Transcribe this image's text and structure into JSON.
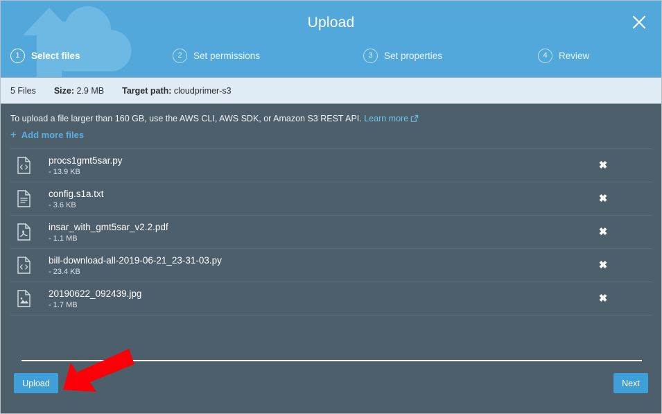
{
  "header": {
    "title": "Upload",
    "close_label": "✕",
    "watermark_icon": "cloud-upload-icon",
    "steps": [
      {
        "num": "1",
        "label": "Select files",
        "active": true
      },
      {
        "num": "2",
        "label": "Set permissions",
        "active": false
      },
      {
        "num": "3",
        "label": "Set properties",
        "active": false
      },
      {
        "num": "4",
        "label": "Review",
        "active": false
      }
    ]
  },
  "infobar": {
    "file_count": "5 Files",
    "size_key": "Size:",
    "size_value": "2.9 MB",
    "target_key": "Target path:",
    "target_value": "cloudprimer-s3"
  },
  "notice": {
    "text": "To upload a file larger than 160 GB, use the AWS CLI, AWS SDK, or Amazon S3 REST API.",
    "link_label": "Learn more",
    "link_icon": "external-link-icon"
  },
  "add_more": {
    "plus": "+",
    "label": "Add more files"
  },
  "files": [
    {
      "name": "procs1gmt5sar.py",
      "size": "- 13.9 KB",
      "icon": "code-file-icon",
      "remove": "✖"
    },
    {
      "name": "config.s1a.txt",
      "size": "- 3.6 KB",
      "icon": "text-file-icon",
      "remove": "✖"
    },
    {
      "name": "insar_with_gmt5sar_v2.2.pdf",
      "size": "- 1.1 MB",
      "icon": "pdf-file-icon",
      "remove": "✖"
    },
    {
      "name": "bill-download-all-2019-06-21_23-31-03.py",
      "size": "- 23.4 KB",
      "icon": "code-file-icon",
      "remove": "✖"
    },
    {
      "name": "20190622_092439.jpg",
      "size": "- 1.7 MB",
      "icon": "image-file-icon",
      "remove": "✖"
    }
  ],
  "footer": {
    "upload_label": "Upload",
    "next_label": "Next"
  },
  "annotation": {
    "arrow_icon": "red-arrow-annotation",
    "color": "#fb0007",
    "points_to": "Upload"
  },
  "colors": {
    "header_blue": "#53a8db",
    "body_slate": "#4c5f6b",
    "infobar": "#dfecf5",
    "button_blue": "#3f9fd8",
    "link_blue": "#6fc4e8"
  }
}
